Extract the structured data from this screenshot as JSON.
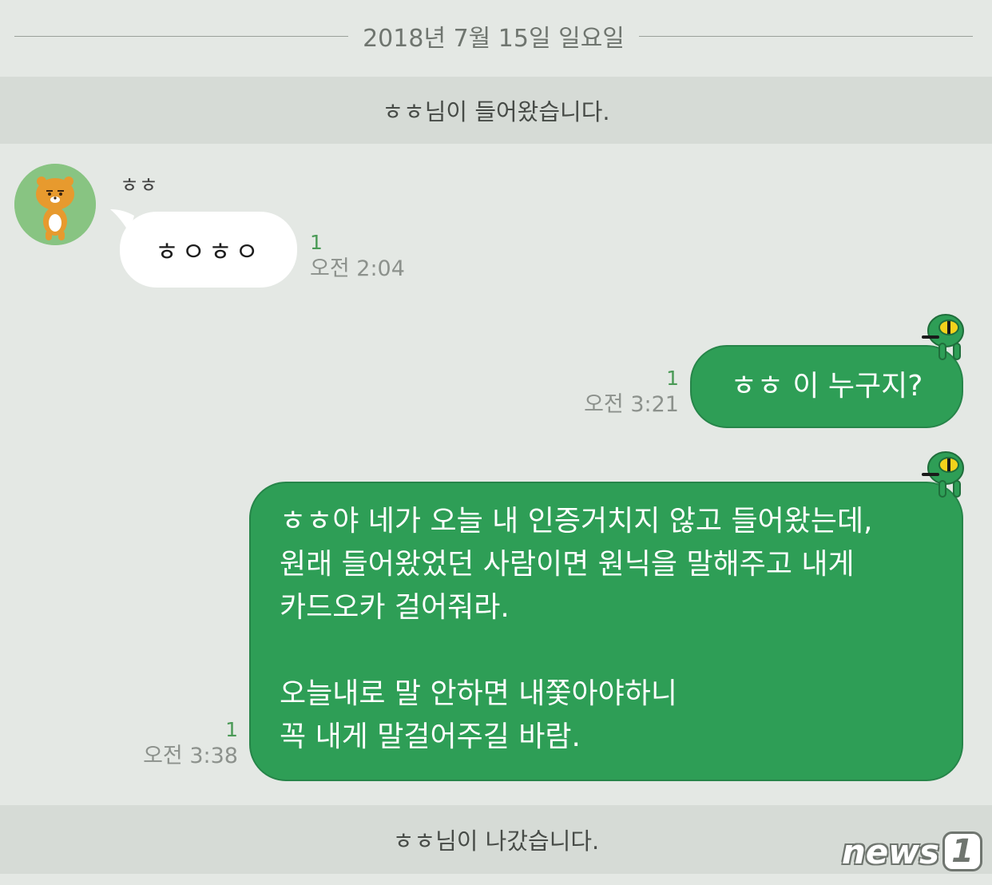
{
  "date_divider": "2018년 7월 15일 일요일",
  "system": {
    "joined": "ㅎㅎ님이 들어왔습니다.",
    "left": "ㅎㅎ님이 나갔습니다."
  },
  "messages": [
    {
      "direction": "incoming",
      "sender": "ㅎㅎ",
      "avatar_icon": "ryan-bear-avatar-icon",
      "text": "ㅎㅇㅎㅇ",
      "unread": "1",
      "time": "오전 2:04"
    },
    {
      "direction": "outgoing",
      "text": "ㅎㅎ 이 누구지?",
      "unread": "1",
      "time": "오전 3:21"
    },
    {
      "direction": "outgoing",
      "text": "ㅎㅎ야 네가 오늘 내 인증거치지 않고 들어왔는데,\n원래 들어왔었던 사람이면 원닉을 말해주고 내게\n카드오카 걸어줘라.\n\n오늘내로 말 안하면 내쫓아야하니\n꼭 내게 말걸어주길 바람.",
      "unread": "1",
      "time": "오전 3:38"
    }
  ],
  "watermark": {
    "text": "news",
    "number": "1"
  },
  "colors": {
    "background": "#e4e8e4",
    "banner": "#d6dbd6",
    "outgoing_bubble": "#2e9e56",
    "incoming_bubble": "#ffffff",
    "unread": "#4a9a56"
  }
}
